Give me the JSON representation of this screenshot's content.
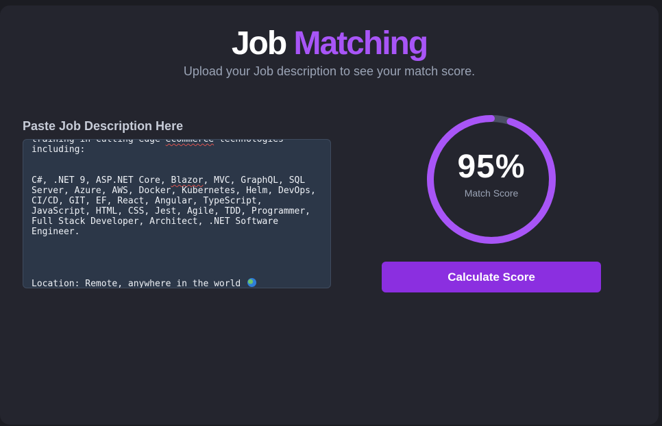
{
  "header": {
    "title_part1": "Job",
    "title_part2": "Matching",
    "subtitle": "Upload your Job description to see your match score."
  },
  "job_description": {
    "label": "Paste Job Description Here",
    "line1_before": "training in cutting-edge ",
    "line1_flagged": "ecommerce",
    "line1_after": " technologies",
    "line2": "including:",
    "tech_before": "C#, .NET 9, ASP.NET Core, ",
    "tech_flagged": "Blazor",
    "tech_after": ", MVC, GraphQL, SQL Server, Azure, AWS, Docker, Kubernetes, Helm, DevOps, CI/CD, GIT, EF, React, Angular, TypeScript, JavaScript, HTML, CSS, Jest, Agile, TDD, Programmer, Full Stack Developer, Architect, .NET Software Engineer.",
    "location": "Location: Remote, anywhere in the world"
  },
  "score": {
    "value": 95,
    "value_text": "95%",
    "label": "Match Score"
  },
  "actions": {
    "calculate_label": "Calculate Score"
  },
  "colors": {
    "accent": "#a855f7",
    "button": "#8b2fe0",
    "ring_track": "#4b5064",
    "card": "#24252e"
  }
}
